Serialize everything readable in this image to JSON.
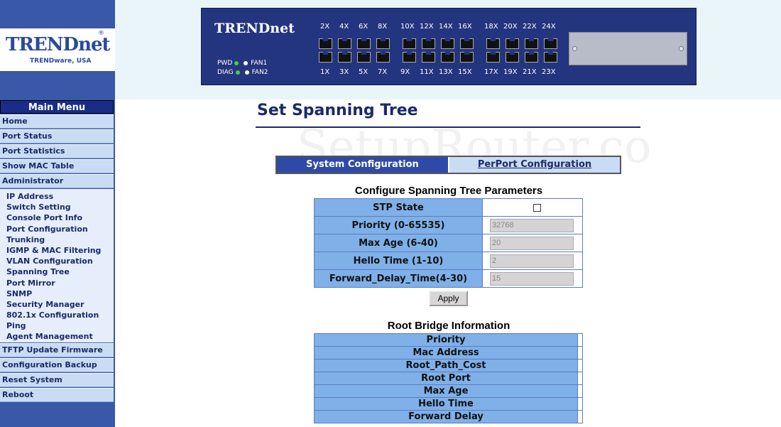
{
  "logo": {
    "brand": "TRENDnet",
    "reg": "®",
    "tagline": "TRENDware, USA"
  },
  "device": {
    "brand": "TRENDnet",
    "leds": {
      "pwd": "PWD",
      "fan1": "FAN1",
      "diag": "DIAG",
      "fan2": "FAN2"
    },
    "top_ports": [
      "2X",
      "4X",
      "6X",
      "8X",
      "10X",
      "12X",
      "14X",
      "16X",
      "18X",
      "20X",
      "22X",
      "24X"
    ],
    "bottom_ports": [
      "1X",
      "3X",
      "5X",
      "7X",
      "9X",
      "11X",
      "13X",
      "15X",
      "17X",
      "19X",
      "21X",
      "23X"
    ]
  },
  "menu": {
    "header": "Main Menu",
    "items_top": [
      "Home",
      "Port Status",
      "Port Statistics",
      "Show MAC Table",
      "Administrator"
    ],
    "sub_items": [
      "IP Address",
      "Switch Setting",
      "Console Port Info",
      "Port Configuration",
      "Trunking",
      "IGMP & MAC Filtering",
      "VLAN Configuration",
      "Spanning Tree",
      "Port Mirror",
      "SNMP",
      "Security Manager",
      "802.1x Configuration",
      "Ping",
      "Agent Management"
    ],
    "items_bottom": [
      "TFTP Update Firmware",
      "Configuration Backup",
      "Reset System",
      "Reboot"
    ]
  },
  "page": {
    "title": "Set Spanning Tree",
    "watermark": "SetupRouter.co"
  },
  "tabs": {
    "system": "System Configuration",
    "perport": "PerPort Configuration"
  },
  "config": {
    "title": "Configure Spanning Tree Parameters",
    "stp_state_label": "STP State",
    "stp_state_checked": false,
    "fields": [
      {
        "label": "Priority (0-65535)",
        "value": "32768"
      },
      {
        "label": "Max Age (6-40)",
        "value": "20"
      },
      {
        "label": "Hello Time (1-10)",
        "value": "2"
      },
      {
        "label": "Forward_Delay_Time(4-30)",
        "value": "15"
      }
    ],
    "apply_label": "Apply"
  },
  "root_bridge": {
    "title": "Root Bridge Information",
    "rows": [
      "Priority",
      "Mac Address",
      "Root_Path_Cost",
      "Root Port",
      "Max Age",
      "Hello Time",
      "Forward Delay"
    ]
  }
}
